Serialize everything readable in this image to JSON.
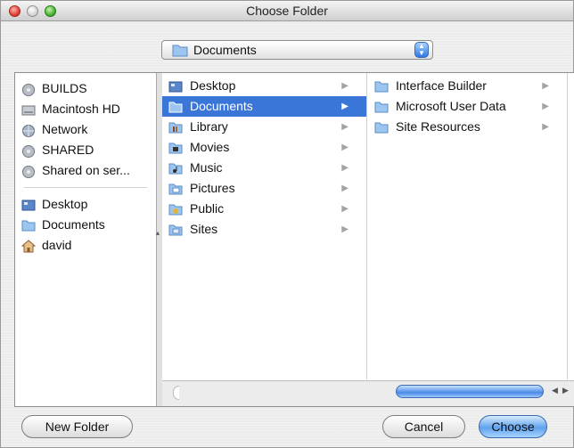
{
  "window": {
    "title": "Choose Folder"
  },
  "location_popup": {
    "value": "Documents"
  },
  "sidebar": {
    "devices": [
      {
        "label": "BUILDS",
        "icon": "network-disk-icon"
      },
      {
        "label": "Macintosh HD",
        "icon": "hard-drive-icon"
      },
      {
        "label": "Network",
        "icon": "network-globe-icon"
      },
      {
        "label": "SHARED",
        "icon": "network-disk-icon"
      },
      {
        "label": "Shared on ser...",
        "icon": "network-disk-icon"
      }
    ],
    "places": [
      {
        "label": "Desktop",
        "icon": "desktop-icon"
      },
      {
        "label": "Documents",
        "icon": "folder-icon"
      },
      {
        "label": "david",
        "icon": "home-icon"
      }
    ]
  },
  "column1": {
    "items": [
      {
        "label": "Desktop",
        "icon": "desktop-icon"
      },
      {
        "label": "Documents",
        "icon": "folder-icon"
      },
      {
        "label": "Library",
        "icon": "library-folder-icon"
      },
      {
        "label": "Movies",
        "icon": "movies-folder-icon"
      },
      {
        "label": "Music",
        "icon": "music-folder-icon"
      },
      {
        "label": "Pictures",
        "icon": "pictures-folder-icon"
      },
      {
        "label": "Public",
        "icon": "public-folder-icon"
      },
      {
        "label": "Sites",
        "icon": "sites-folder-icon"
      }
    ],
    "selected": "Documents"
  },
  "column2": {
    "items": [
      {
        "label": "Interface Builder",
        "icon": "folder-icon"
      },
      {
        "label": "Microsoft User Data",
        "icon": "folder-icon"
      },
      {
        "label": "Site Resources",
        "icon": "folder-icon"
      }
    ]
  },
  "buttons": {
    "new_folder": "New Folder",
    "cancel": "Cancel",
    "choose": "Choose"
  },
  "colors": {
    "selection": "#3976d8",
    "default_button": "#5fa2ee"
  }
}
